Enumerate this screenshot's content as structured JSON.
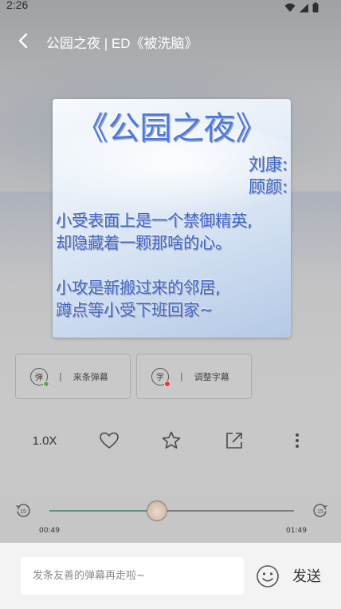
{
  "status_bar": {
    "time": "2:26",
    "icons": [
      "wifi-icon",
      "signal-icon",
      "battery-icon"
    ]
  },
  "header": {
    "title": "公园之夜 | ED《被洗脑》"
  },
  "cover": {
    "title": "《公园之夜》",
    "names": [
      "刘康:",
      "顾颜:"
    ],
    "lines": [
      "小受表面上是一个禁御精英,",
      "却隐藏着一颗那啥的心。",
      "小攻是新搬过来的邻居,",
      "蹲点等小受下班回家~"
    ]
  },
  "options": [
    {
      "icon_char": "弹",
      "label": "来条弹幕",
      "dot_color": "#4caf50"
    },
    {
      "icon_char": "字",
      "label": "调整字幕",
      "dot_color": "#e53935"
    }
  ],
  "controls": {
    "speed": "1.0X",
    "icons": [
      "heart-icon",
      "star-icon",
      "share-icon",
      "more-icon"
    ]
  },
  "player": {
    "current_time": "00:49",
    "total_time": "01:49",
    "skip_seconds": "15",
    "progress": 0.44
  },
  "bottom": {
    "comment_placeholder": "发条友善的弹幕再走啦~",
    "send_label": "发送"
  },
  "colors": {
    "accent": "#5f8f85",
    "cover_text": "#3b64c6"
  }
}
